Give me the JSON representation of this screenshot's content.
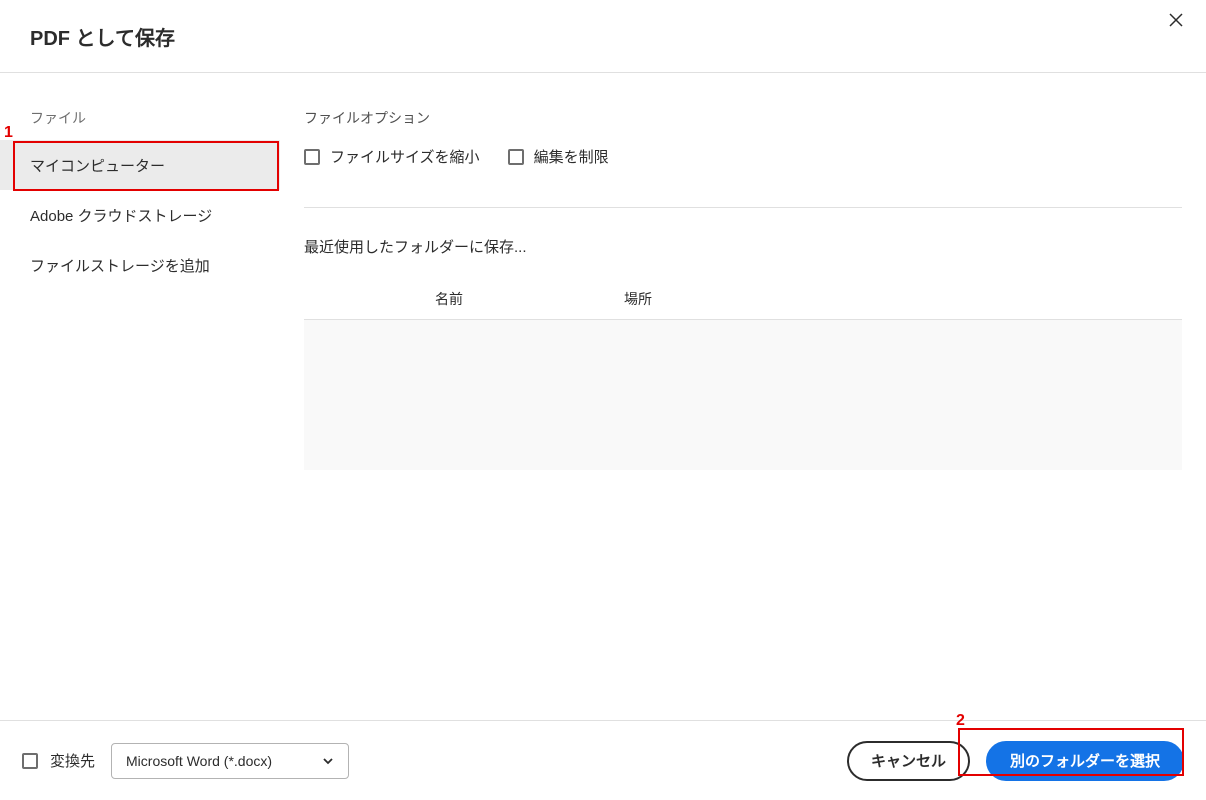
{
  "header": {
    "title": "PDF として保存"
  },
  "sidebar": {
    "label": "ファイル",
    "items": [
      {
        "label": "マイコンピューター",
        "active": true
      },
      {
        "label": "Adobe クラウドストレージ",
        "active": false
      },
      {
        "label": "ファイルストレージを追加",
        "active": false
      }
    ]
  },
  "main": {
    "options_label": "ファイルオプション",
    "option_reduce_size": "ファイルサイズを縮小",
    "option_restrict_edit": "編集を制限",
    "recent_label": "最近使用したフォルダーに保存...",
    "col_name": "名前",
    "col_location": "場所"
  },
  "footer": {
    "convert_label": "変換先",
    "dropdown_value": "Microsoft Word (*.docx)",
    "cancel_label": "キャンセル",
    "select_folder_label": "別のフォルダーを選択"
  },
  "annotations": {
    "num1": "1",
    "num2": "2"
  }
}
